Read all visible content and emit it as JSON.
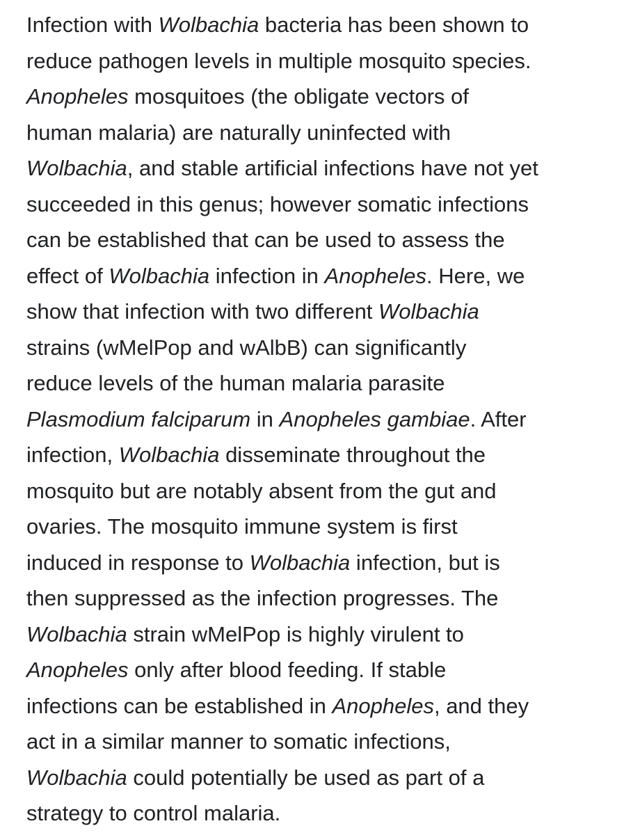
{
  "abstract": {
    "lines": [
      [
        {
          "t": "Infection with "
        },
        {
          "t": "Wolbachia",
          "i": true
        },
        {
          "t": " bacteria has been shown to"
        }
      ],
      [
        {
          "t": "reduce pathogen levels in multiple mosquito species."
        }
      ],
      [
        {
          "t": "Anopheles",
          "i": true
        },
        {
          "t": " mosquitoes (the obligate vectors of"
        }
      ],
      [
        {
          "t": "human malaria) are naturally uninfected with"
        }
      ],
      [
        {
          "t": "Wolbachia",
          "i": true
        },
        {
          "t": ", and stable artificial infections have not yet"
        }
      ],
      [
        {
          "t": "succeeded in this genus; however somatic infections"
        }
      ],
      [
        {
          "t": "can be established that can be used to assess the"
        }
      ],
      [
        {
          "t": "effect of "
        },
        {
          "t": "Wolbachia",
          "i": true
        },
        {
          "t": " infection in "
        },
        {
          "t": "Anopheles",
          "i": true
        },
        {
          "t": ". Here, we"
        }
      ],
      [
        {
          "t": "show that infection with two different "
        },
        {
          "t": "Wolbachia",
          "i": true
        }
      ],
      [
        {
          "t": "strains (wMelPop and wAlbB) can significantly"
        }
      ],
      [
        {
          "t": "reduce levels of the human malaria parasite"
        }
      ],
      [
        {
          "t": "Plasmodium falciparum",
          "i": true
        },
        {
          "t": " in "
        },
        {
          "t": "Anopheles gambiae",
          "i": true
        },
        {
          "t": ". After"
        }
      ],
      [
        {
          "t": "infection, "
        },
        {
          "t": "Wolbachia",
          "i": true
        },
        {
          "t": " disseminate throughout the"
        }
      ],
      [
        {
          "t": "mosquito but are notably absent from the gut and"
        }
      ],
      [
        {
          "t": "ovaries. The mosquito immune system is first"
        }
      ],
      [
        {
          "t": "induced in response to "
        },
        {
          "t": "Wolbachia",
          "i": true
        },
        {
          "t": " infection, but is"
        }
      ],
      [
        {
          "t": "then suppressed as the infection progresses. The"
        }
      ],
      [
        {
          "t": "Wolbachia",
          "i": true
        },
        {
          "t": " strain wMelPop is highly virulent to"
        }
      ],
      [
        {
          "t": "Anopheles",
          "i": true
        },
        {
          "t": " only after blood feeding. If stable"
        }
      ],
      [
        {
          "t": "infections can be established in "
        },
        {
          "t": "Anopheles",
          "i": true
        },
        {
          "t": ", and they"
        }
      ],
      [
        {
          "t": "act in a similar manner to somatic infections,"
        }
      ],
      [
        {
          "t": "Wolbachia",
          "i": true
        },
        {
          "t": " could potentially be used as part of a"
        }
      ],
      [
        {
          "t": "strategy to control malaria."
        }
      ]
    ]
  }
}
